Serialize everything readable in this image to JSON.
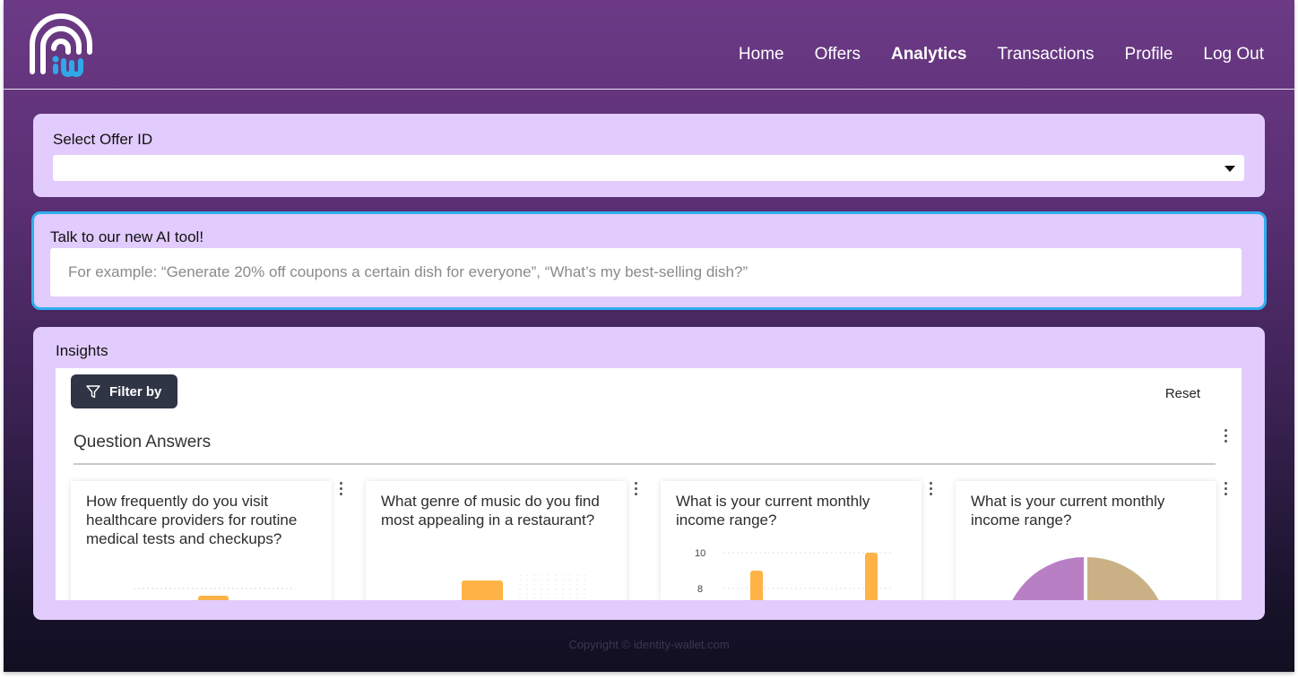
{
  "header": {
    "nav": [
      "Home",
      "Offers",
      "Analytics",
      "Transactions",
      "Profile",
      "Log Out"
    ],
    "active_nav": "Analytics"
  },
  "offer_select": {
    "label": "Select Offer ID",
    "value": ""
  },
  "ai_tool": {
    "label": "Talk to our new AI tool!",
    "placeholder": "For example: “Generate 20% off coupons a certain dish for everyone”, “What’s my best-selling dish?”",
    "accent_color": "#2eaef0"
  },
  "insights": {
    "label": "Insights",
    "filter_label": "Filter by",
    "reset_label": "Reset",
    "section_title": "Question Answers",
    "cards": [
      {
        "title": "How frequently do you visit healthcare providers for routine medical tests and checkups?"
      },
      {
        "title": "What genre of music do you find most appealing in a restaurant?"
      },
      {
        "title": "What is your current monthly income range?",
        "y_ticks": [
          "10",
          "8"
        ]
      },
      {
        "title": "What is your current monthly income range?"
      }
    ]
  },
  "footer": {
    "copyright": "Copyright © identity-wallet.com"
  },
  "colors": {
    "card_bg": "#e2ccfd",
    "bar": "#ffb347",
    "pie_purple": "#b97fc4",
    "pie_tan": "#c9b185",
    "button_dark": "#2f3545"
  }
}
